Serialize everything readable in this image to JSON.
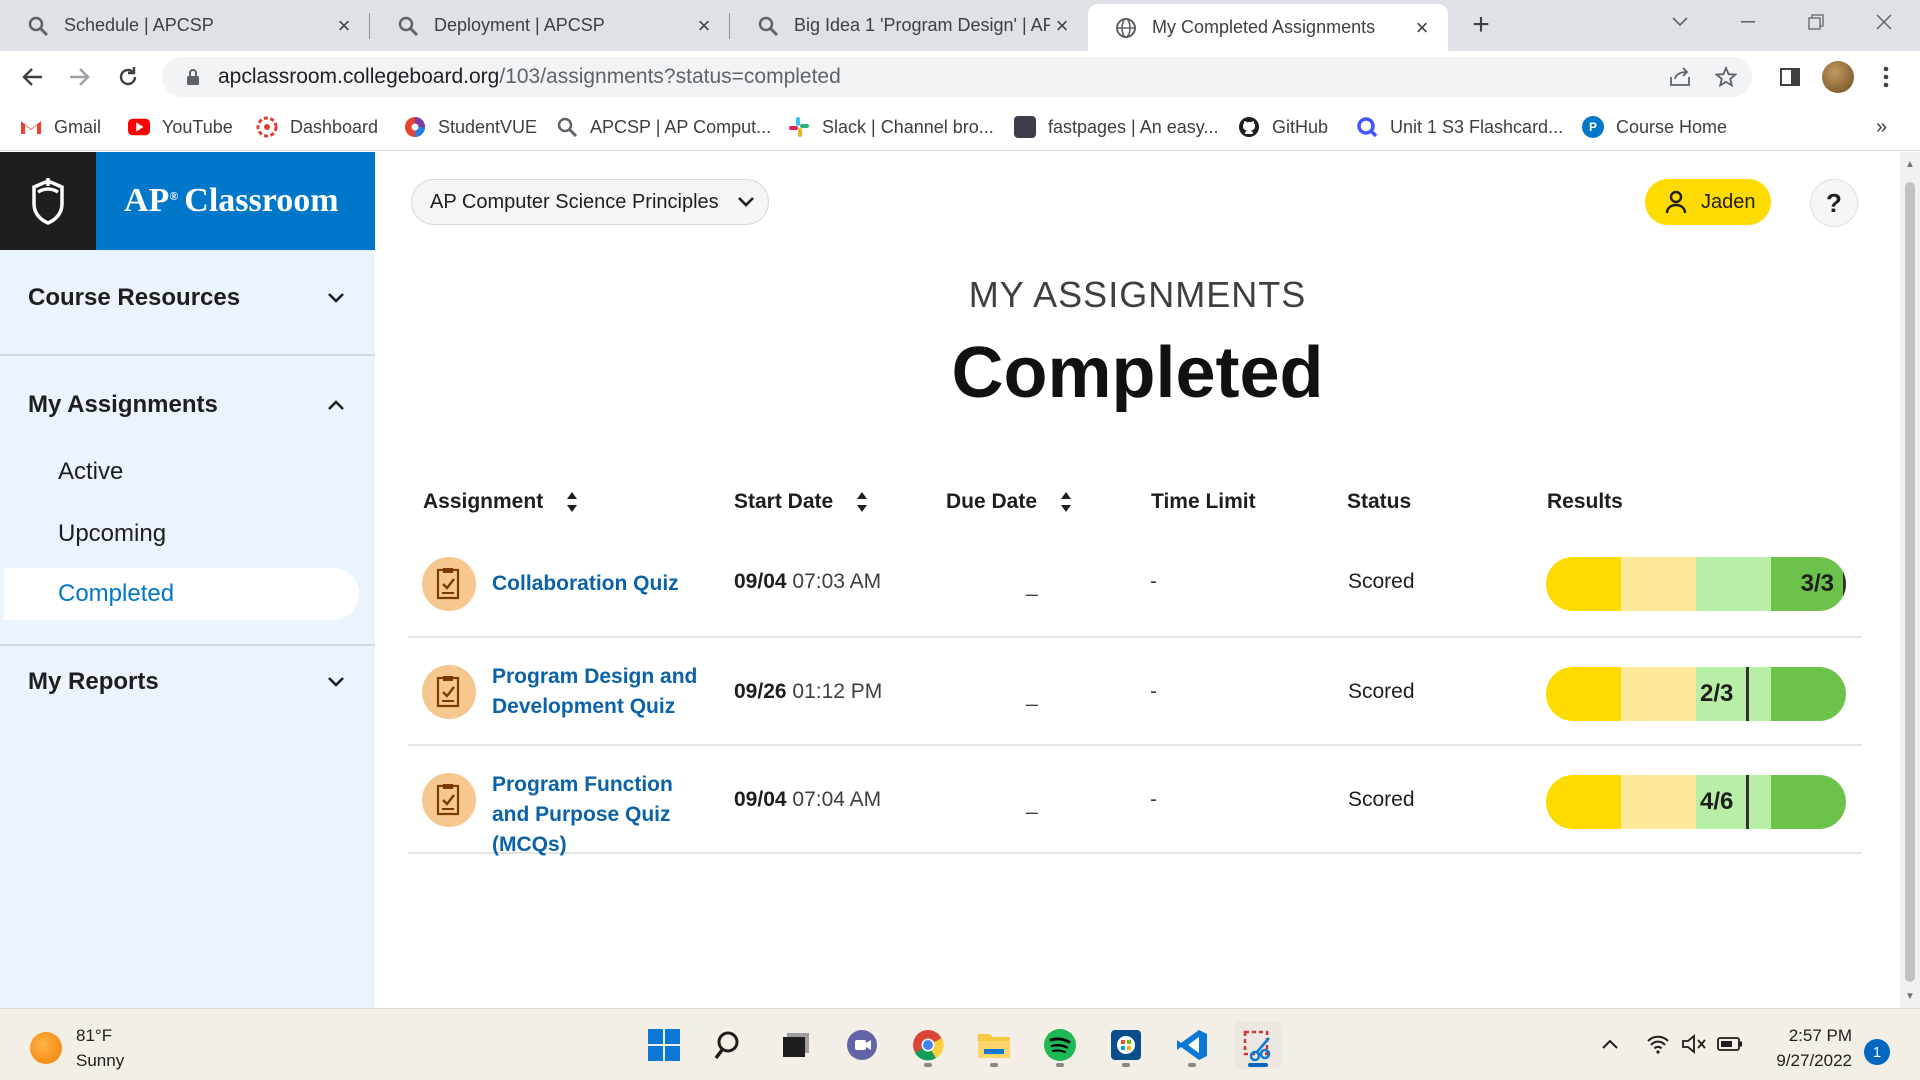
{
  "browser": {
    "tabs": [
      {
        "title": "Schedule | APCSP",
        "icon": "apcsp-favicon",
        "active": false
      },
      {
        "title": "Deployment | APCSP",
        "icon": "apcsp-favicon",
        "active": false
      },
      {
        "title": "Big Idea 1 'Program Design' | AP",
        "icon": "apcsp-favicon",
        "active": false
      },
      {
        "title": "My Completed Assignments",
        "icon": "globe-icon",
        "active": true
      }
    ],
    "url_host": "apclassroom.collegeboard.org",
    "url_path": "/103/assignments?status=completed",
    "bookmarks": [
      {
        "label": "Gmail",
        "icon": "gmail-icon",
        "color": "#ea4335"
      },
      {
        "label": "YouTube",
        "icon": "youtube-icon",
        "color": "#ff0000"
      },
      {
        "label": "Dashboard",
        "icon": "dashboard-icon",
        "color": "#e03c31"
      },
      {
        "label": "StudentVUE",
        "icon": "studentvue-icon",
        "color": "#7b3fa0"
      },
      {
        "label": "APCSP | AP Comput...",
        "icon": "apcsp-favicon",
        "color": "#555555"
      },
      {
        "label": "Slack | Channel bro...",
        "icon": "slack-icon",
        "color": "#4a154b"
      },
      {
        "label": "fastpages | An easy...",
        "icon": "fastpages-icon",
        "color": "#333333"
      },
      {
        "label": "GitHub",
        "icon": "github-icon",
        "color": "#1b1f23"
      },
      {
        "label": "Unit 1 S3 Flashcard...",
        "icon": "quizlet-icon",
        "color": "#4255ff"
      },
      {
        "label": "Course Home",
        "icon": "pearson-icon",
        "color": "#0077c8"
      }
    ],
    "more_bookmarks": "»"
  },
  "app": {
    "brand_ap": "AP",
    "brand_reg": "®",
    "brand_classroom": "Classroom",
    "course": "AP Computer Science Principles",
    "user": "Jaden",
    "help": "?"
  },
  "sidebar": {
    "course_resources": "Course Resources",
    "my_assignments": "My Assignments",
    "sub": {
      "active": "Active",
      "upcoming": "Upcoming",
      "completed": "Completed"
    },
    "my_reports": "My Reports"
  },
  "main": {
    "kicker": "MY ASSIGNMENTS",
    "title": "Completed",
    "headers": {
      "assignment": "Assignment",
      "start_date": "Start Date",
      "due_date": "Due Date",
      "time_limit": "Time Limit",
      "status": "Status",
      "results": "Results"
    },
    "rows": [
      {
        "name": "Collaboration Quiz",
        "start_day": "09/04",
        "start_time": "07:03 AM",
        "due": "_",
        "limit": "-",
        "status": "Scored",
        "score": "3/3",
        "fraction": 1.0
      },
      {
        "name": "Program Design and Development Quiz",
        "start_day": "09/26",
        "start_time": "01:12 PM",
        "due": "_",
        "limit": "-",
        "status": "Scored",
        "score": "2/3",
        "fraction": 0.667
      },
      {
        "name": "Program Function and Purpose Quiz (MCQs)",
        "start_day": "09/04",
        "start_time": "07:04 AM",
        "due": "_",
        "limit": "-",
        "status": "Scored",
        "score": "4/6",
        "fraction": 0.667
      }
    ],
    "result_colors": [
      "#fedb00",
      "#fde99a",
      "#b8eea5",
      "#6cc24a"
    ]
  },
  "taskbar": {
    "temp": "81°F",
    "condition": "Sunny",
    "time": "2:57 PM",
    "date": "9/27/2022",
    "notifications": "1"
  }
}
